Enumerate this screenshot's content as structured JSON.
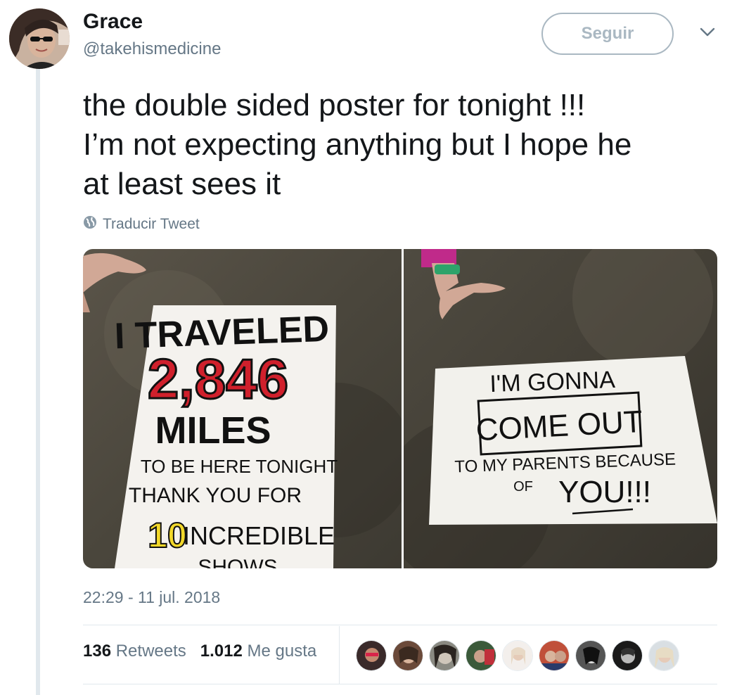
{
  "user": {
    "name": "Grace",
    "handle": "@takehismedicine",
    "avatar_icon": "profile-photo-sunglasses"
  },
  "follow_button": {
    "label": "Seguir"
  },
  "menu_caret_icon": "chevron-down-icon",
  "tweet": {
    "lines": [
      "the double sided poster for tonight !!!",
      "I’m not expecting anything but I hope he",
      "at least sees it"
    ]
  },
  "translate": {
    "label": "Traducir Tweet",
    "icon": "globe-icon"
  },
  "media": {
    "left_poster": {
      "line1": "I TRAVELED",
      "number": "2,846",
      "line3": "MILES",
      "line4": "TO BE HERE TONIGHT",
      "line5": "THANK YOU FOR",
      "count": "10",
      "line6": "INCREDIBLE",
      "line7": "SHOWS"
    },
    "right_poster": {
      "line1": "I'M GONNA",
      "line2": "COME OUT",
      "line3": "TO MY PARENTS BECAUSE",
      "line4": "OF",
      "line5": "YOU!!!"
    }
  },
  "timestamp": "22:29 - 11 jul. 2018",
  "stats": {
    "retweets_count": "136",
    "retweets_label": "Retweets",
    "likes_count": "1.012",
    "likes_label": "Me gusta"
  },
  "likers": [
    {
      "icon": "liker-avatar-1",
      "color": "#3a2a2a"
    },
    {
      "icon": "liker-avatar-2",
      "color": "#6b4a3a"
    },
    {
      "icon": "liker-avatar-3",
      "color": "#8a8a82"
    },
    {
      "icon": "liker-avatar-4",
      "color": "#3b5a3a"
    },
    {
      "icon": "liker-avatar-5",
      "color": "#f3efec"
    },
    {
      "icon": "liker-avatar-6",
      "color": "#c0503a"
    },
    {
      "icon": "liker-avatar-7",
      "color": "#555555"
    },
    {
      "icon": "liker-avatar-8",
      "color": "#1a1a1a"
    },
    {
      "icon": "liker-avatar-9",
      "color": "#d9dfe3"
    }
  ],
  "colors": {
    "text_primary": "#14171a",
    "text_secondary": "#657786",
    "border": "#e1e8ed",
    "button_border": "#aab8c2",
    "poster_red": "#d0202c",
    "poster_yellow": "#f2d82a"
  }
}
